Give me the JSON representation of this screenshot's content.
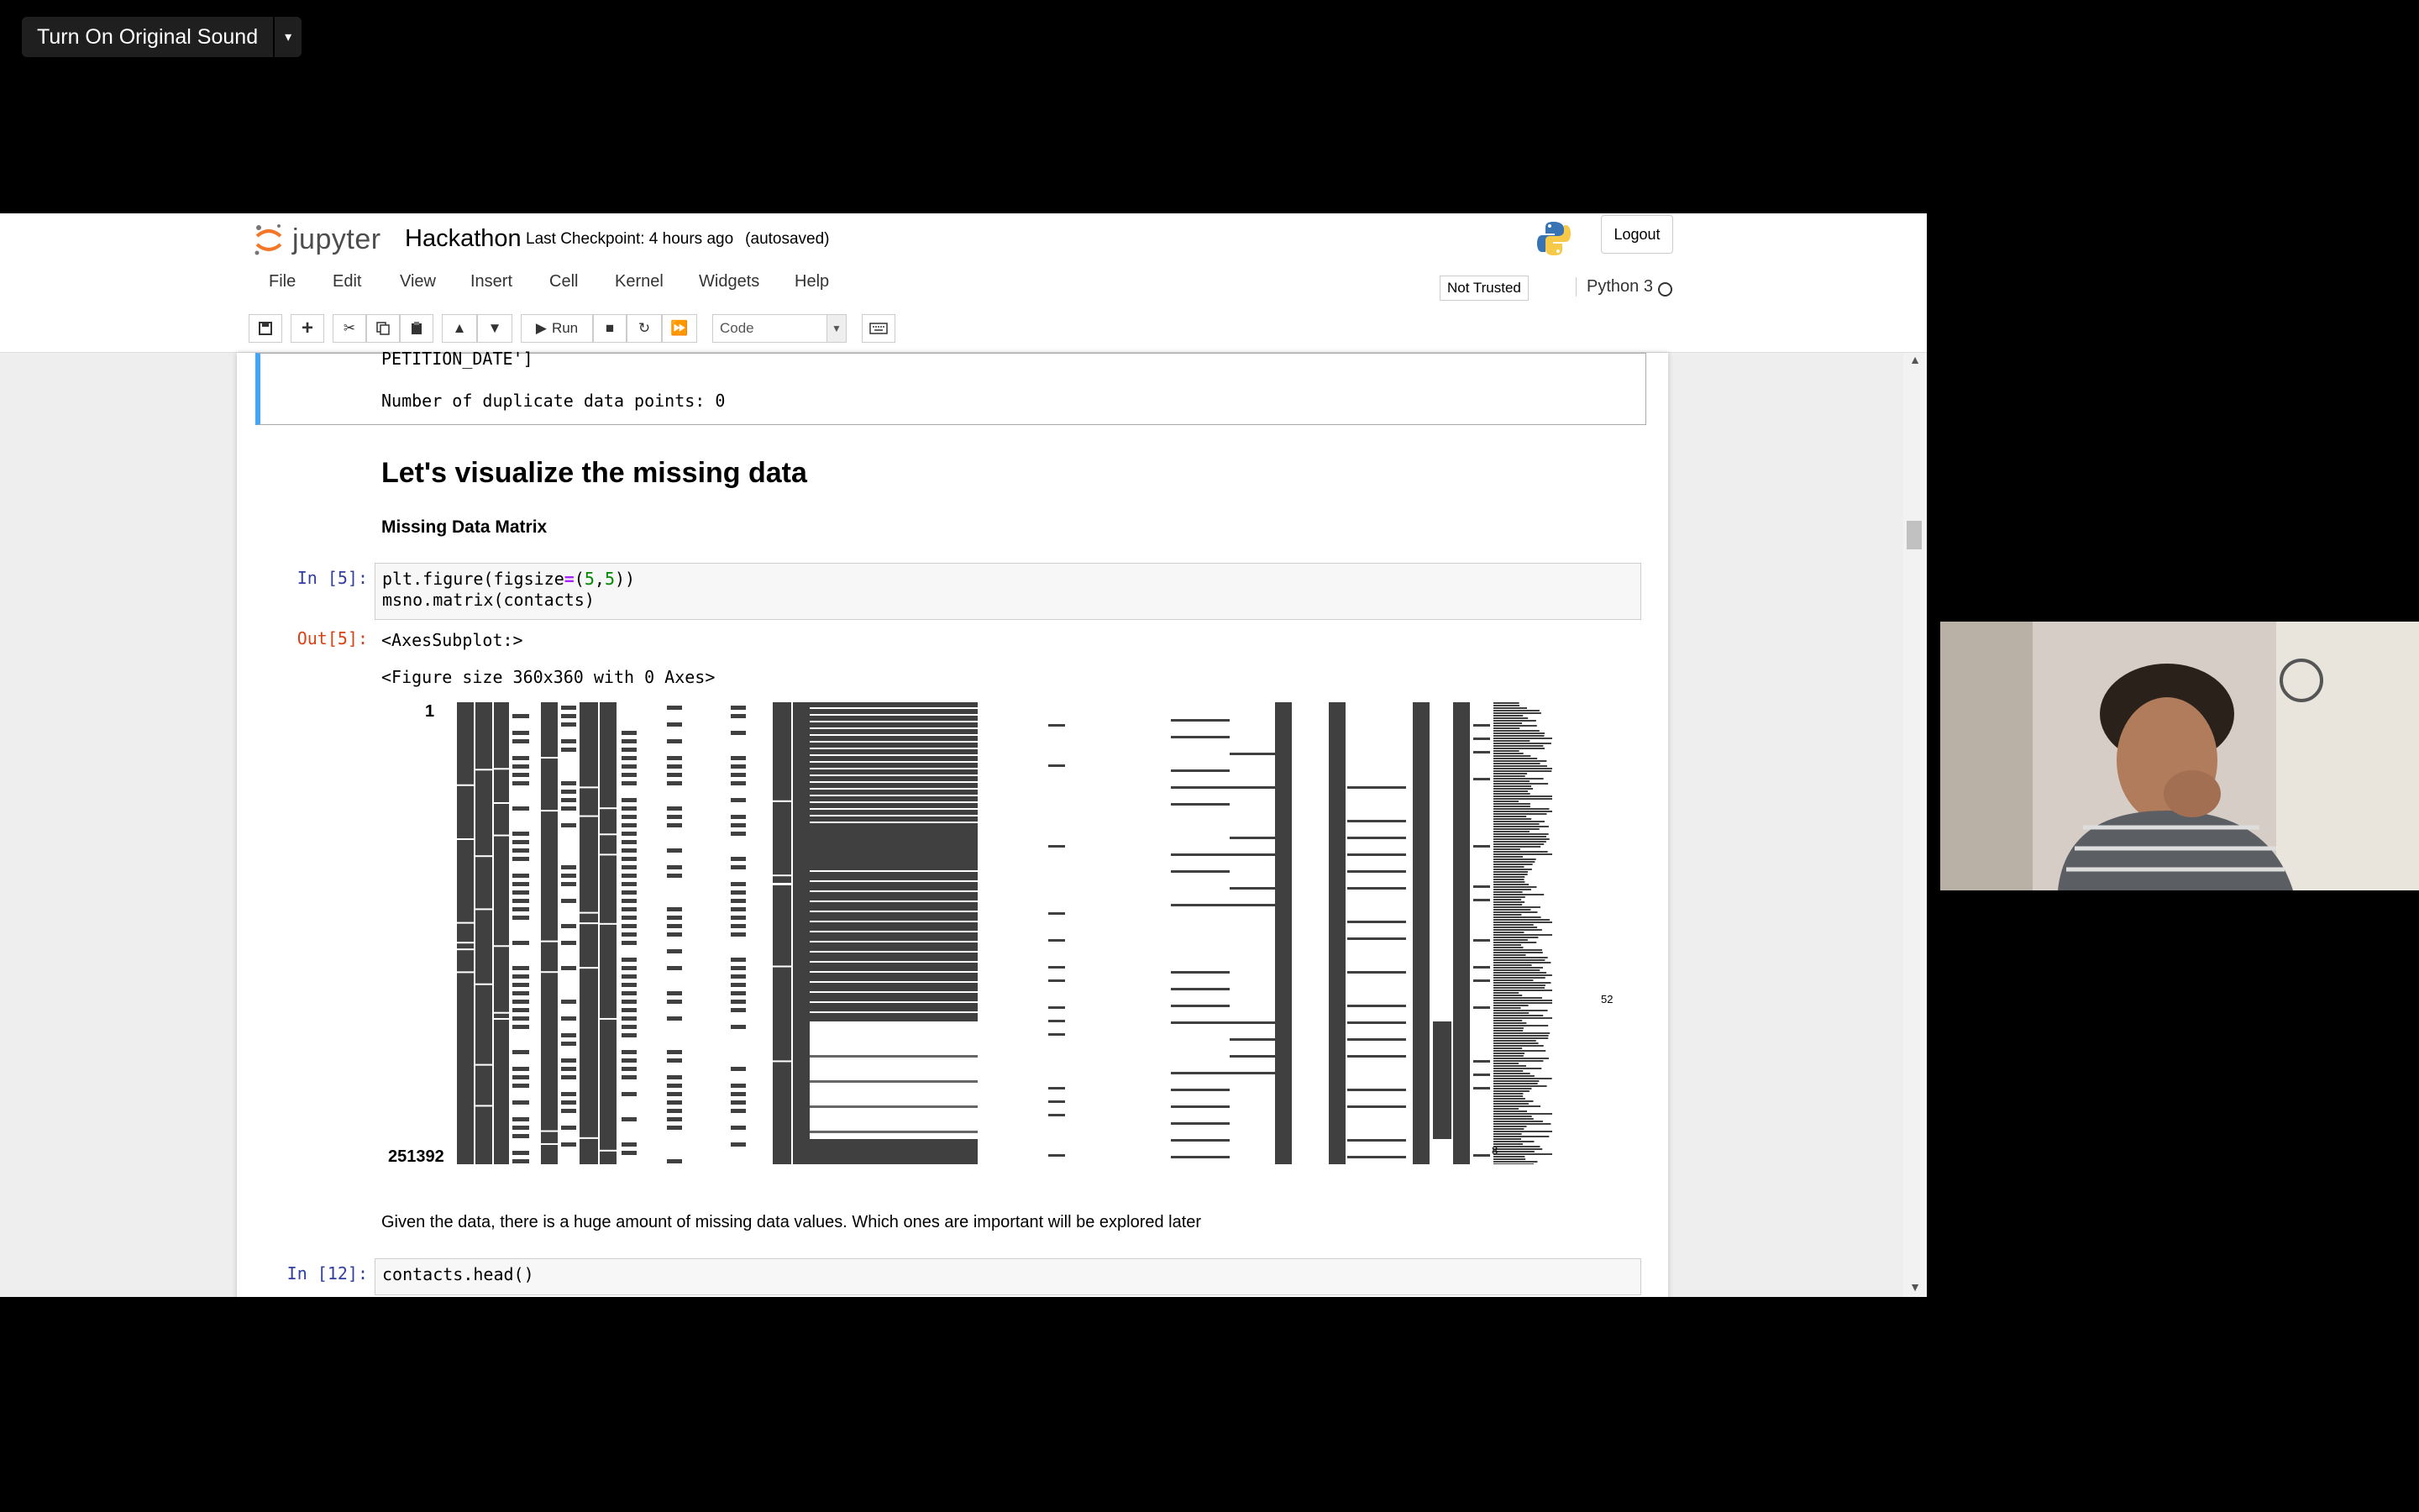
{
  "overlay": {
    "sound_button": "Turn On Original Sound",
    "caret": "▾"
  },
  "header": {
    "logo_text": "jupyter",
    "notebook_name": "Hackathon",
    "checkpoint": "Last Checkpoint: 4 hours ago",
    "autosaved": "(autosaved)",
    "logout": "Logout"
  },
  "menu": {
    "items": [
      "File",
      "Edit",
      "View",
      "Insert",
      "Cell",
      "Kernel",
      "Widgets",
      "Help"
    ],
    "not_trusted": "Not Trusted",
    "kernel_name": "Python 3"
  },
  "toolbar": {
    "run_label": "Run",
    "cell_type": "Code"
  },
  "cells": {
    "prev_output_line1": "PETITION_DATE']",
    "prev_output_line2": "Number of duplicate data points: 0",
    "heading": "Let's visualize the missing data",
    "subheading": "Missing Data Matrix",
    "cell5": {
      "in_prompt": "In [5]:",
      "code_l1_a": "plt.figure(figsize",
      "code_l1_op": "=",
      "code_l1_b": "(",
      "code_l1_n1": "5",
      "code_l1_c": ",",
      "code_l1_n2": "5",
      "code_l1_d": "))",
      "code_l2": "msno.matrix(contacts)",
      "out_prompt": "Out[5]:",
      "out_l1": "<AxesSubplot:>",
      "out_l2": "<Figure size 360x360 with 0 Axes>"
    },
    "plot": {
      "y_top": "1",
      "y_bottom": "251392",
      "spark_max": "52",
      "spark_min": "8"
    },
    "note": "Given the data, there is a huge amount of missing data values. Which ones are important will be explored later",
    "cell12": {
      "in_prompt": "In [12]:",
      "code": "contacts.head()"
    }
  },
  "colors": {
    "accent": "#42a5f5",
    "prompt_in": "#303f9f",
    "prompt_out": "#d84315",
    "matrix_fill": "#404040"
  }
}
